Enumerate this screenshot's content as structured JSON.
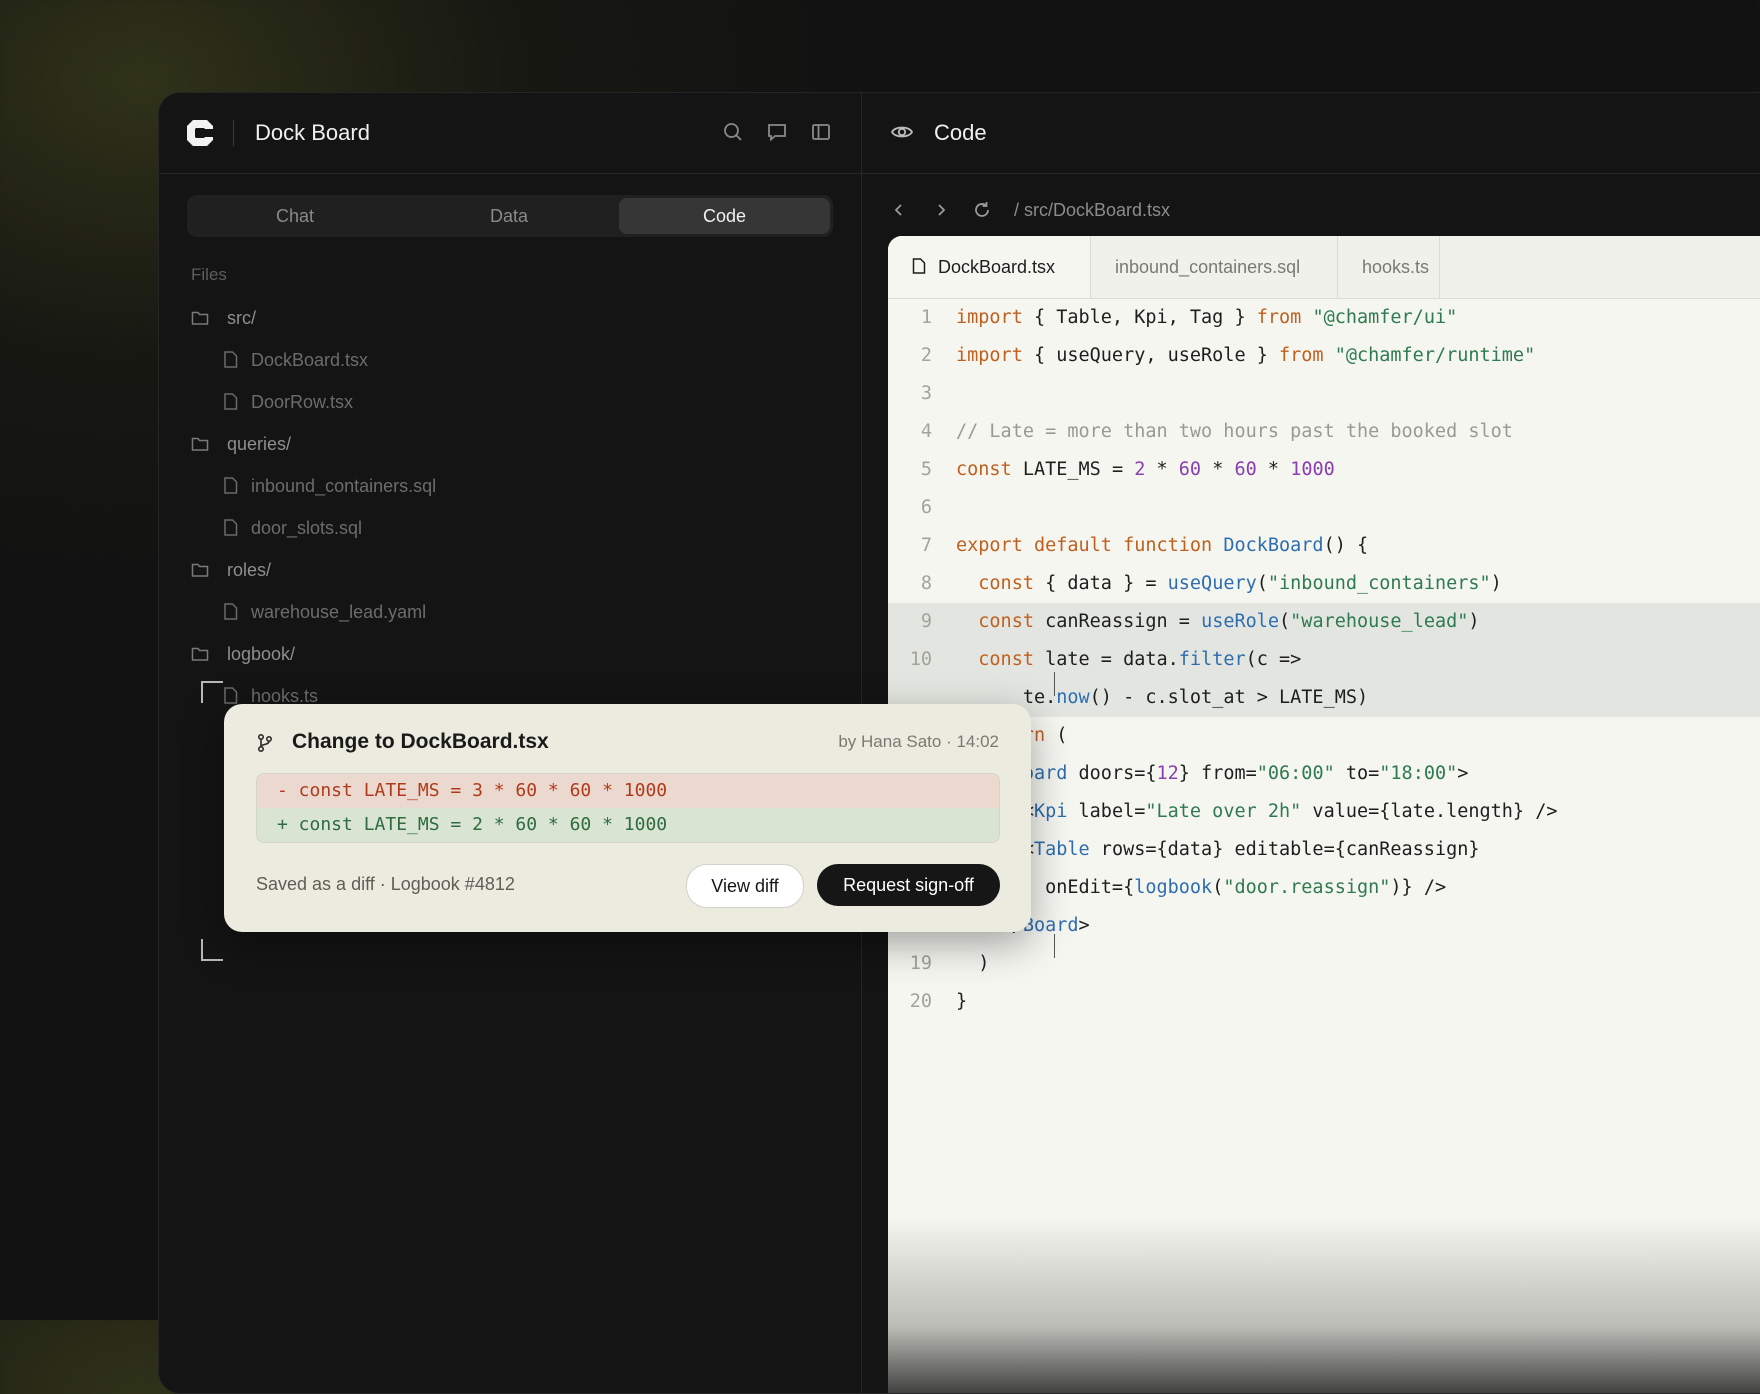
{
  "sidebar": {
    "app_title": "Dock Board",
    "tabs": [
      {
        "label": "Chat",
        "active": false
      },
      {
        "label": "Data",
        "active": false
      },
      {
        "label": "Code",
        "active": true
      }
    ],
    "files_label": "Files",
    "tree": [
      {
        "type": "folder",
        "name": "src/"
      },
      {
        "type": "file",
        "name": "DockBoard.tsx"
      },
      {
        "type": "file",
        "name": "DoorRow.tsx"
      },
      {
        "type": "folder",
        "name": "queries/"
      },
      {
        "type": "file",
        "name": "inbound_containers.sql"
      },
      {
        "type": "file",
        "name": "door_slots.sql"
      },
      {
        "type": "folder",
        "name": "roles/"
      },
      {
        "type": "file",
        "name": "warehouse_lead.yaml"
      },
      {
        "type": "folder",
        "name": "logbook/"
      },
      {
        "type": "file",
        "name": "hooks.ts"
      }
    ]
  },
  "code_panel": {
    "title": "Code",
    "path": "/ src/DockBoard.tsx",
    "tabs": [
      {
        "label": "DockBoard.tsx",
        "active": true
      },
      {
        "label": "inbound_containers.sql",
        "active": false
      },
      {
        "label": "hooks.ts",
        "active": false
      }
    ],
    "lines": [
      {
        "n": "1",
        "text": "import { Table, Kpi, Tag } from \"@chamfer/ui\""
      },
      {
        "n": "2",
        "text": "import { useQuery, useRole } from \"@chamfer/runtime\""
      },
      {
        "n": "3",
        "text": ""
      },
      {
        "n": "4",
        "text": "// Late = more than two hours past the booked slot"
      },
      {
        "n": "5",
        "text": "const LATE_MS = 2 * 60 * 60 * 1000"
      },
      {
        "n": "6",
        "text": ""
      },
      {
        "n": "7",
        "text": "export default function DockBoard() {"
      },
      {
        "n": "8",
        "text": "  const { data } = useQuery(\"inbound_containers\")"
      },
      {
        "n": "9",
        "text": "  const canReassign = useRole(\"warehouse_lead\")",
        "highlight": true
      },
      {
        "n": "10",
        "text": "  const late = data.filter(c =>",
        "highlight": true
      },
      {
        "n": "",
        "text": "      te.now() - c.slot_at > LATE_MS)",
        "highlight": true
      },
      {
        "n": "",
        "text": "      rn ("
      },
      {
        "n": "",
        "text": "      oard doors={12} from=\"06:00\" to=\"18:00\">"
      },
      {
        "n": "",
        "text": "      <Kpi label=\"Late over 2h\" value={late.length} />"
      },
      {
        "n": "",
        "text": "      <Table rows={data} editable={canReassign}"
      },
      {
        "n": "17",
        "text": "        onEdit={logbook(\"door.reassign\")} />"
      },
      {
        "n": "18",
        "text": "    </Board>"
      },
      {
        "n": "19",
        "text": "  )"
      },
      {
        "n": "20",
        "text": "}"
      }
    ]
  },
  "popup": {
    "title": "Change to DockBoard.tsx",
    "meta": "by Hana Sato · 14:02",
    "diff_removed": "- const LATE_MS = 3 * 60 * 60 * 1000",
    "diff_added": "+ const LATE_MS = 2 * 60 * 60 * 1000",
    "footer": "Saved as a diff · Logbook #4812",
    "view_label": "View diff",
    "request_label": "Request sign-off"
  },
  "colors": {
    "keyword": "#c0601f",
    "string": "#2f7a4f",
    "number": "#8a3fb0",
    "function": "#2e6db0",
    "comment": "#9a9a93",
    "diff_removed": "#b23a1c",
    "diff_added": "#2e6b3e"
  },
  "icons": [
    "logo-icon",
    "search-icon",
    "chat-icon",
    "panel-toggle-icon",
    "eye-icon",
    "chevron-left-icon",
    "chevron-right-icon",
    "refresh-icon",
    "folder-icon",
    "file-icon",
    "branch-icon"
  ]
}
